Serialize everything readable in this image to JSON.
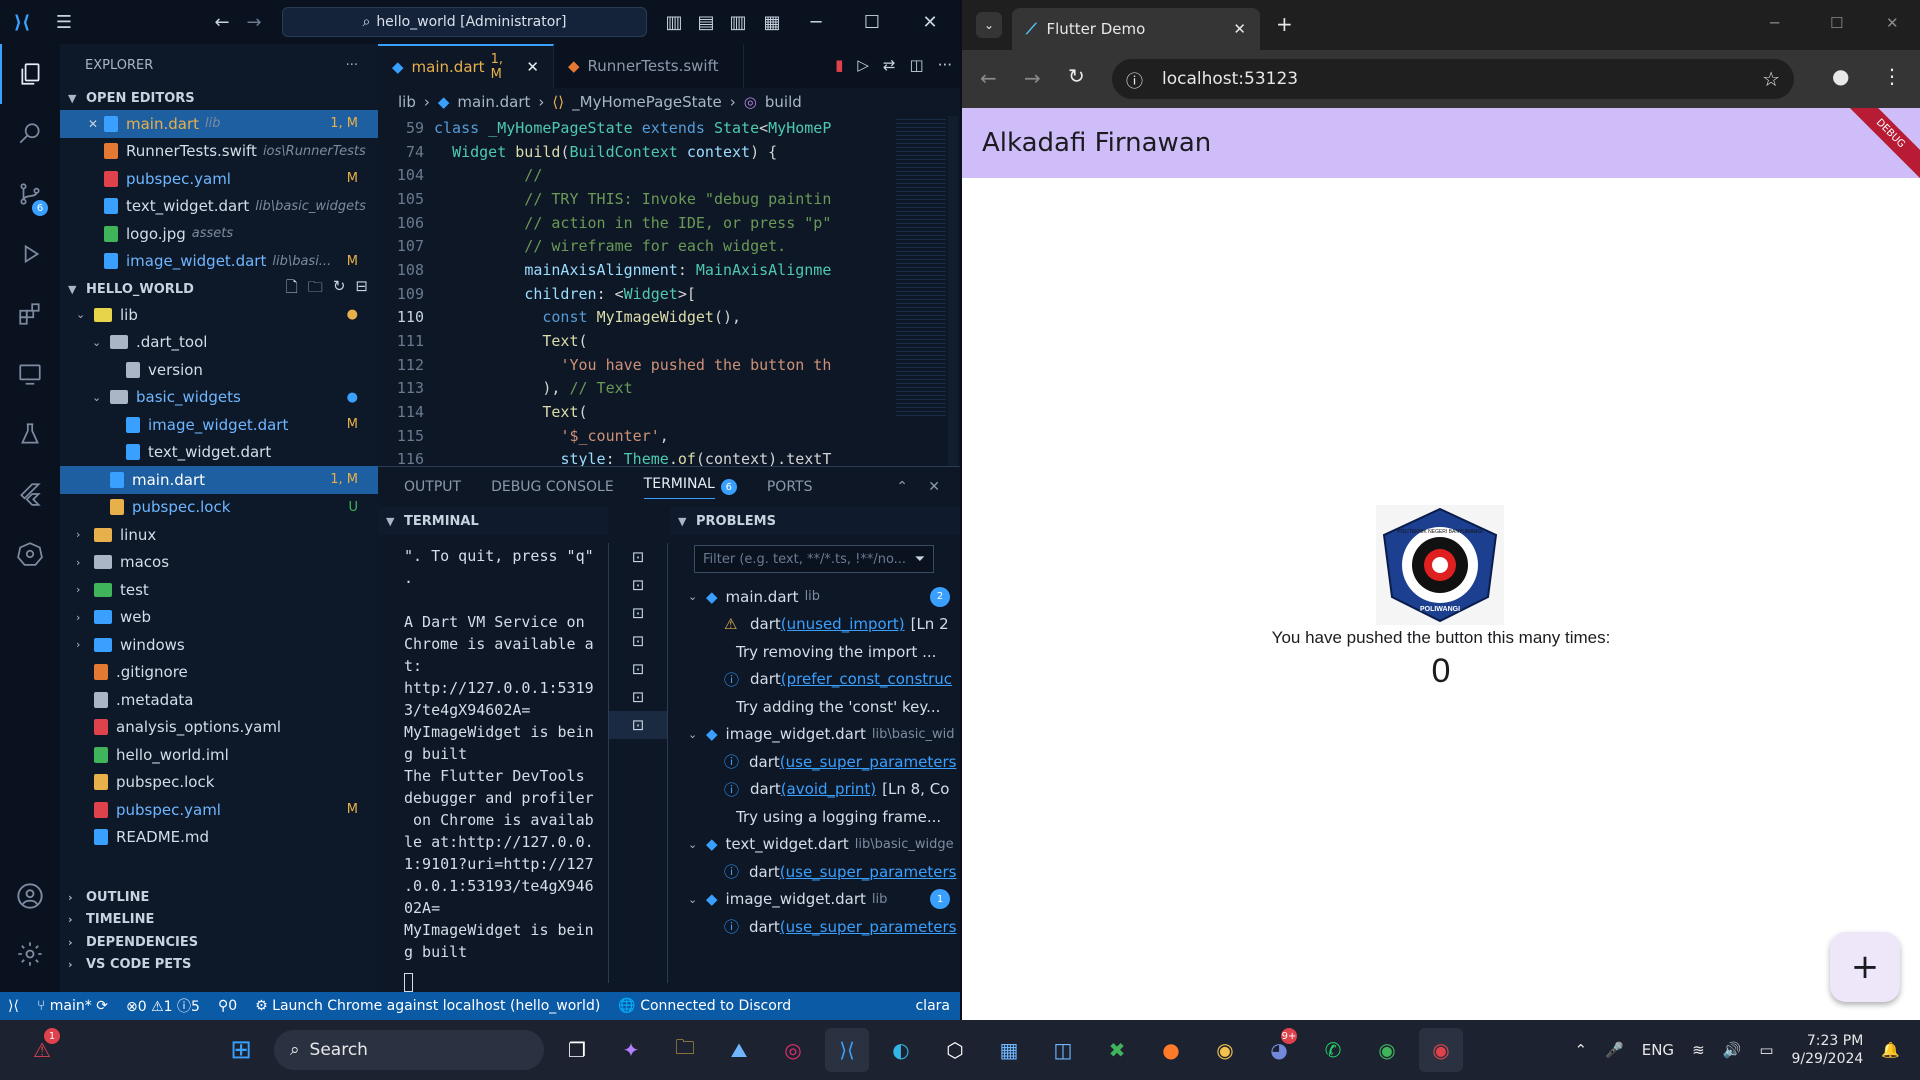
{
  "vscode": {
    "command_center": "hello_world [Administrator]",
    "explorer_title": "EXPLORER",
    "open_editors_label": "OPEN EDITORS",
    "open_editors": [
      {
        "name": "main.dart",
        "desc": "lib",
        "status": "1, M",
        "color": "#3aa0ff",
        "status_color": "#e8b04a",
        "active": true
      },
      {
        "name": "RunnerTests.swift",
        "desc": "ios\\RunnerTests",
        "status": "",
        "color": "#e37933"
      },
      {
        "name": "pubspec.yaml",
        "desc": "",
        "status": "M",
        "color": "#e0424c",
        "status_color": "#e8b04a"
      },
      {
        "name": "text_widget.dart",
        "desc": "lib\\basic_widgets",
        "status": "",
        "color": "#3aa0ff"
      },
      {
        "name": "logo.jpg",
        "desc": "assets",
        "status": "",
        "color": "#3fb45a"
      },
      {
        "name": "image_widget.dart",
        "desc": "lib\\basi...",
        "status": "M",
        "color": "#3aa0ff",
        "status_color": "#e8b04a"
      }
    ],
    "project_label": "HELLO_WORLD",
    "tree": [
      {
        "name": "lib",
        "indent": 1,
        "kind": "folder-open",
        "color": "#e8d44a",
        "status": "●",
        "status_color": "#e8b04a"
      },
      {
        "name": ".dart_tool",
        "indent": 2,
        "kind": "folder-open",
        "color": "#aab6c6",
        "status": ""
      },
      {
        "name": "version",
        "indent": 3,
        "kind": "file",
        "color": "#aab6c6",
        "status": ""
      },
      {
        "name": "basic_widgets",
        "indent": 2,
        "kind": "folder-open",
        "color": "#aab6c6",
        "status": "●",
        "status_color": "#3aa0ff",
        "text_color": "#6fb6ff"
      },
      {
        "name": "image_widget.dart",
        "indent": 3,
        "kind": "file",
        "color": "#3aa0ff",
        "status": "M",
        "status_color": "#e8b04a",
        "text_color": "#6fb6ff"
      },
      {
        "name": "text_widget.dart",
        "indent": 3,
        "kind": "file",
        "color": "#3aa0ff",
        "status": ""
      },
      {
        "name": "main.dart",
        "indent": 2,
        "kind": "file",
        "color": "#3aa0ff",
        "status": "1, M",
        "status_color": "#e8b04a",
        "selected": true
      },
      {
        "name": "pubspec.lock",
        "indent": 2,
        "kind": "file",
        "color": "#e8b04a",
        "status": "U",
        "status_color": "#3fb45a",
        "text_color": "#6fb6ff"
      },
      {
        "name": "linux",
        "indent": 1,
        "kind": "folder",
        "color": "#e8b04a",
        "status": ""
      },
      {
        "name": "macos",
        "indent": 1,
        "kind": "folder",
        "color": "#aab6c6",
        "status": ""
      },
      {
        "name": "test",
        "indent": 1,
        "kind": "folder",
        "color": "#3fb45a",
        "status": ""
      },
      {
        "name": "web",
        "indent": 1,
        "kind": "folder",
        "color": "#3aa0ff",
        "status": ""
      },
      {
        "name": "windows",
        "indent": 1,
        "kind": "folder",
        "color": "#3aa0ff",
        "status": ""
      },
      {
        "name": ".gitignore",
        "indent": 1,
        "kind": "file",
        "color": "#e37933",
        "status": ""
      },
      {
        "name": ".metadata",
        "indent": 1,
        "kind": "file",
        "color": "#aab6c6",
        "status": ""
      },
      {
        "name": "analysis_options.yaml",
        "indent": 1,
        "kind": "file",
        "color": "#e0424c",
        "status": ""
      },
      {
        "name": "hello_world.iml",
        "indent": 1,
        "kind": "file",
        "color": "#3fb45a",
        "status": ""
      },
      {
        "name": "pubspec.lock",
        "indent": 1,
        "kind": "file",
        "color": "#e8b04a",
        "status": ""
      },
      {
        "name": "pubspec.yaml",
        "indent": 1,
        "kind": "file",
        "color": "#e0424c",
        "status": "M",
        "status_color": "#e8b04a",
        "text_color": "#6fb6ff"
      },
      {
        "name": "README.md",
        "indent": 1,
        "kind": "file",
        "color": "#3aa0ff",
        "status": ""
      }
    ],
    "bottom_sections": [
      "OUTLINE",
      "TIMELINE",
      "DEPENDENCIES",
      "VS CODE PETS"
    ],
    "tabs": [
      {
        "label": "main.dart",
        "status": "1, M",
        "active": true
      },
      {
        "label": "RunnerTests.swift",
        "status": ""
      }
    ],
    "breadcrumb": [
      "lib",
      "main.dart",
      "_MyHomePageState",
      "build"
    ],
    "code_lines": [
      {
        "n": "59",
        "t": [
          [
            "kw",
            "class "
          ],
          [
            "cls",
            "_MyHomePageState "
          ],
          [
            "kw",
            "extends "
          ],
          [
            "cls",
            "State"
          ],
          [
            "pl",
            "<"
          ],
          [
            "cls",
            "MyHomeP"
          ]
        ]
      },
      {
        "n": "74",
        "t": [
          [
            "pl",
            "  "
          ],
          [
            "cls",
            "Widget "
          ],
          [
            "fn",
            "build"
          ],
          [
            "pl",
            "("
          ],
          [
            "cls",
            "BuildContext "
          ],
          [
            "pr",
            "context"
          ],
          [
            "pl",
            ") {"
          ]
        ]
      },
      {
        "n": "104",
        "t": [
          [
            "cm",
            "          //"
          ]
        ]
      },
      {
        "n": "105",
        "t": [
          [
            "cm",
            "          // TRY THIS: Invoke \"debug paintin"
          ]
        ]
      },
      {
        "n": "106",
        "t": [
          [
            "cm",
            "          // action in the IDE, or press \"p\""
          ]
        ]
      },
      {
        "n": "107",
        "t": [
          [
            "cm",
            "          // wireframe for each widget."
          ]
        ]
      },
      {
        "n": "108",
        "t": [
          [
            "pl",
            "          "
          ],
          [
            "pr",
            "mainAxisAlignment"
          ],
          [
            "pl",
            ": "
          ],
          [
            "cls",
            "MainAxisAlignme"
          ]
        ]
      },
      {
        "n": "109",
        "t": [
          [
            "pl",
            "          "
          ],
          [
            "pr",
            "children"
          ],
          [
            "pl",
            ": <"
          ],
          [
            "cls",
            "Widget"
          ],
          [
            "pl",
            ">["
          ]
        ]
      },
      {
        "n": "110",
        "t": [
          [
            "pl",
            "            "
          ],
          [
            "kw",
            "const "
          ],
          [
            "fn",
            "MyImageWidget"
          ],
          [
            "pl",
            "(),"
          ]
        ]
      },
      {
        "n": "111",
        "t": [
          [
            "pl",
            "            "
          ],
          [
            "fn",
            "Text"
          ],
          [
            "pl",
            "("
          ]
        ]
      },
      {
        "n": "112",
        "t": [
          [
            "pl",
            "              "
          ],
          [
            "str",
            "'You have pushed the button th"
          ]
        ]
      },
      {
        "n": "113",
        "t": [
          [
            "pl",
            "            ), "
          ],
          [
            "cm",
            "// Text"
          ]
        ]
      },
      {
        "n": "114",
        "t": [
          [
            "pl",
            "            "
          ],
          [
            "fn",
            "Text"
          ],
          [
            "pl",
            "("
          ]
        ]
      },
      {
        "n": "115",
        "t": [
          [
            "pl",
            "              "
          ],
          [
            "str",
            "'$_counter'"
          ],
          [
            "pl",
            ","
          ]
        ]
      },
      {
        "n": "116",
        "t": [
          [
            "pl",
            "              "
          ],
          [
            "pr",
            "style"
          ],
          [
            "pl",
            ": "
          ],
          [
            "cls",
            "Theme"
          ],
          [
            "pl",
            "."
          ],
          [
            "fn",
            "of"
          ],
          [
            "pl",
            "(context).textT"
          ]
        ]
      }
    ],
    "panel_tabs": [
      "OUTPUT",
      "DEBUG CONSOLE",
      "TERMINAL",
      "PORTS"
    ],
    "terminal_badge": "6",
    "terminal_title": "TERMINAL",
    "problems_title": "PROBLEMS",
    "problems_filter_placeholder": "Filter (e.g. text, **/*.ts, !**/no...",
    "terminal_lines": [
      "\". To quit, press \"q\"",
      ".",
      "",
      "A Dart VM Service on",
      "Chrome is available a",
      "t:",
      "http://127.0.0.1:5319",
      "3/te4gX94602A=",
      "MyImageWidget is bein",
      "g built",
      "The Flutter DevTools",
      "debugger and profiler",
      " on Chrome is availab",
      "le at:http://127.0.0.",
      "1:9101?uri=http://127",
      ".0.0.1:53193/te4gX946",
      "02A=",
      "MyImageWidget is bein",
      "g built"
    ],
    "problems": [
      {
        "type": "file",
        "name": "main.dart",
        "desc": "lib",
        "count": "2"
      },
      {
        "type": "warn",
        "src": "dart",
        "code": "(unused_import)",
        "tail": "[Ln 2"
      },
      {
        "type": "hint",
        "text": "Try removing the import ..."
      },
      {
        "type": "info",
        "src": "dart",
        "code": "(prefer_const_construc",
        "tail": ""
      },
      {
        "type": "hint",
        "text": "Try adding the 'const' key..."
      },
      {
        "type": "file",
        "name": "image_widget.dart",
        "desc": "lib\\basic_wid",
        "count": ""
      },
      {
        "type": "info",
        "src": "dart",
        "code": "(use_super_parameters",
        "tail": ""
      },
      {
        "type": "info",
        "src": "dart",
        "code": "(avoid_print)",
        "tail": "[Ln 8, Co"
      },
      {
        "type": "hint",
        "text": "Try using a logging frame..."
      },
      {
        "type": "file",
        "name": "text_widget.dart",
        "desc": "lib\\basic_widge",
        "count": ""
      },
      {
        "type": "info",
        "src": "dart",
        "code": "(use_super_parameters",
        "tail": ""
      },
      {
        "type": "file",
        "name": "image_widget.dart",
        "desc": "lib",
        "count": "1"
      },
      {
        "type": "info",
        "src": "dart",
        "code": "(use_super_parameters",
        "tail": ""
      }
    ],
    "status": {
      "branch": "main*",
      "errors": "0",
      "warnings": "1",
      "infos": "5",
      "ports": "0",
      "launch": "Launch Chrome against localhost (hello_world)",
      "discord": "Connected to Discord",
      "user": "clara"
    },
    "scm_badge": "6"
  },
  "chrome": {
    "tab_title": "Flutter Demo",
    "url": "localhost:53123",
    "app_title": "Alkadafi Firnawan",
    "debug_banner": "DEBUG",
    "logo_text": "POLITEKNIK NEGERI BANYUWANGI",
    "logo_sub": "POLIWANGI",
    "counter_label": "You have pushed the button this many times:",
    "counter_value": "0",
    "fab_label": "+"
  },
  "taskbar": {
    "search": "Search",
    "lang": "ENG",
    "time": "7:23 PM",
    "date": "9/29/2024",
    "notify_badge": "1",
    "discord_badge": "9+"
  }
}
